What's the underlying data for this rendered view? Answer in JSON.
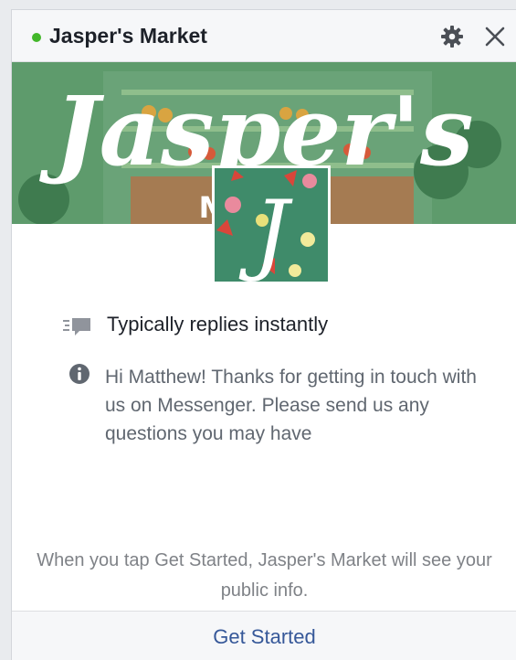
{
  "header": {
    "title": "Jasper's Market",
    "status": "online",
    "status_color": "#42b72a",
    "icons": [
      "gear-icon",
      "close-icon"
    ]
  },
  "cover": {
    "brand_word": "Jasper's",
    "sub_word_visible": "M        T"
  },
  "profile": {
    "monogram": "J"
  },
  "reply_info": {
    "icon": "reply-speed-icon",
    "text": "Typically replies instantly"
  },
  "greeting": {
    "icon": "info-icon",
    "text": "Hi Matthew! Thanks for getting in touch with us on Messenger. Please send us any questions you may have"
  },
  "notice": {
    "text": "When you tap Get Started, Jasper's Market will see your public info."
  },
  "footer": {
    "button_label": "Get Started",
    "button_color": "#365899"
  }
}
